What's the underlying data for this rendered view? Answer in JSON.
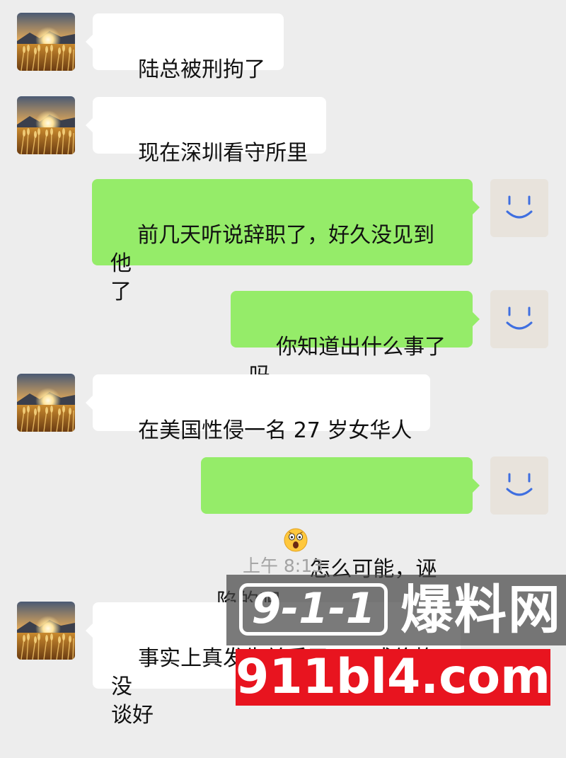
{
  "messages": [
    {
      "side": "left",
      "text": "陆总被刑拘了"
    },
    {
      "side": "left",
      "text": "现在深圳看守所里"
    },
    {
      "side": "right",
      "text": "前几天听说辞职了，好久没见到他\n了"
    },
    {
      "side": "right",
      "text": "你知道出什么事了吗"
    },
    {
      "side": "left",
      "text": "在美国性侵一名 27 岁女华人"
    },
    {
      "side": "right",
      "text": "怎么可能，诬陷的吧",
      "emoji": "astonished-face-emoji"
    },
    {
      "side": "left",
      "text": "事实上真发生关系了，八成价格没\n谈好"
    }
  ],
  "timestamp": "上午 8:13",
  "watermark": {
    "badge": "9-1-1",
    "name": "爆料网",
    "url": "911bl4.com"
  },
  "colors": {
    "background": "#ededed",
    "incoming_bubble": "#ffffff",
    "outgoing_bubble": "#95ec69",
    "watermark_red": "#e8141f"
  },
  "icons": {
    "left_avatar": "sunset-wheat-field-avatar",
    "right_avatar": "smiley-face-avatar"
  }
}
